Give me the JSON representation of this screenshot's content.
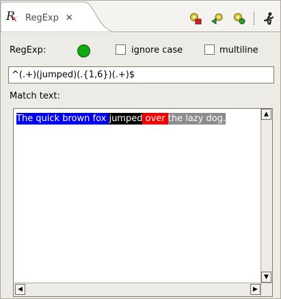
{
  "tab": {
    "title": "RegExp",
    "icon": "regexp-icon",
    "close_icon": "close-icon"
  },
  "toolbar": {
    "buttons": [
      "evaluate-icon",
      "go-icon",
      "settings-icon",
      "run-icon"
    ]
  },
  "regexp_row": {
    "label": "RegExp:",
    "status": "valid",
    "status_color": "#12a812",
    "ignore_case_label": "ignore case",
    "ignore_case_checked": false,
    "multiline_label": "multiline",
    "multiline_checked": false
  },
  "regex_input": {
    "value": "^(.+)(jumped)(.{1,6})(.+)$"
  },
  "match": {
    "label": "Match text:",
    "segments": [
      {
        "text": "The quick brown fox ",
        "color": "#0000f0"
      },
      {
        "text": "jumped",
        "color": "#000000"
      },
      {
        "text": " over ",
        "color": "#f00000"
      },
      {
        "text": "the lazy dog.",
        "color": "#8c8c8c"
      }
    ]
  }
}
